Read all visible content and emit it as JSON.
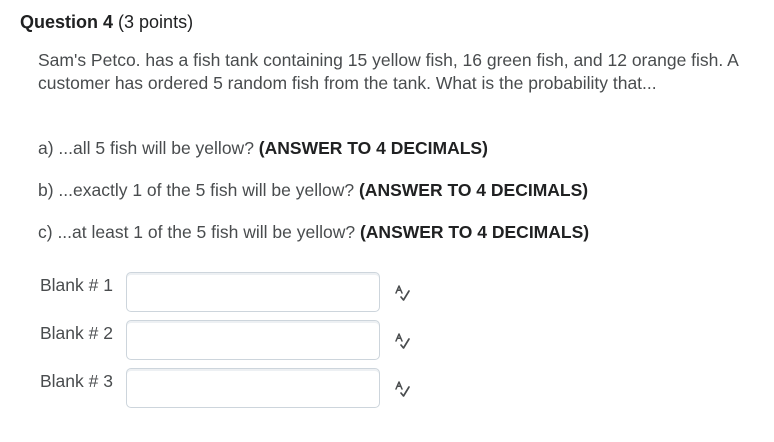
{
  "question": {
    "title": "Question 4",
    "points": "(3 points)",
    "body": "Sam's Petco. has a fish tank containing 15 yellow fish, 16 green fish, and 12 orange fish.  A customer has ordered 5 random fish from the tank.  What is the probability that...",
    "parts": [
      {
        "text": "a) ...all 5 fish will be yellow? ",
        "note": "(ANSWER TO 4 DECIMALS)"
      },
      {
        "text": "b) ...exactly 1 of the 5 fish will be yellow? ",
        "note": "(ANSWER TO 4 DECIMALS)"
      },
      {
        "text": "c) ...at least 1 of the 5 fish will be yellow? ",
        "note": "(ANSWER TO 4 DECIMALS)"
      }
    ]
  },
  "blanks": [
    {
      "label": "Blank # 1",
      "value": ""
    },
    {
      "label": "Blank # 2",
      "value": ""
    },
    {
      "label": "Blank # 3",
      "value": ""
    }
  ],
  "icons": {
    "spellcheck": "spellcheck-icon"
  },
  "colors": {
    "text": "#494c4e",
    "heading": "#202122",
    "input_border": "#cdd5dc",
    "icon": "#494c4e"
  }
}
